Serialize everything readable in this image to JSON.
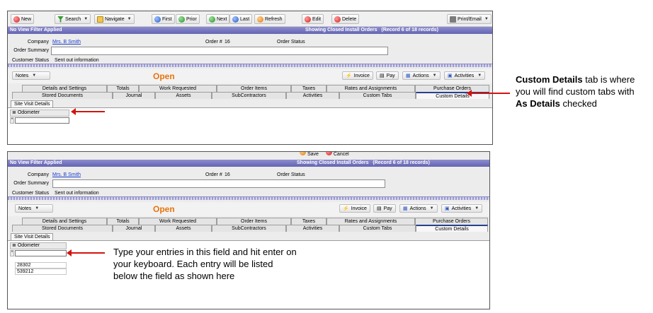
{
  "toolbar": {
    "new": "New",
    "search": "Search",
    "navigate": "Navigate",
    "first": "First",
    "prior": "Prior",
    "next": "Next",
    "last": "Last",
    "refresh": "Refresh",
    "edit": "Edit",
    "delete": "Delete",
    "print_email": "Print/Email"
  },
  "toolbar2": {
    "save": "Save",
    "cancel": "Cancel"
  },
  "bar": {
    "filter": "No View Filter Applied",
    "showing": "Showing Closed Install Orders",
    "record": "(Record 6 of 18 records)"
  },
  "header": {
    "company_label": "Company",
    "company_value": "Mrs. B Smith",
    "order_no_label": "Order #",
    "order_no_value": "16",
    "order_status_label": "Order Status",
    "order_summary_label": "Order Summary",
    "customer_status_label": "Customer Status",
    "customer_status_value": "Sent out information"
  },
  "panel": {
    "notes": "Notes",
    "status": "Open",
    "invoice": "Invoice",
    "pay": "Pay",
    "actions": "Actions",
    "activities": "Activities"
  },
  "tabs_row1": [
    "Details and Settings",
    "Totals",
    "Work Requested",
    "Order Items",
    "Taxes",
    "Rates and Assignments",
    "Purchase Orders"
  ],
  "tabs_row2": [
    "Stored Documents",
    "Journal",
    "Assets",
    "SubContractors",
    "Activities",
    "Custom Tabs",
    "Custom Details"
  ],
  "subtab": "Site Visit Details",
  "grid": {
    "column": "Odometer",
    "row_marker": "*",
    "entries": [
      "28302",
      "539212"
    ]
  },
  "annotations": {
    "top_bold_1": "Custom Details",
    "top_text_1": " tab is where you will find custom tabs with ",
    "top_bold_2": "As Details",
    "top_text_2": " checked",
    "bottom": "Type your entries in this field and hit enter on your keyboard. Each entry will be listed below the field as shown here"
  },
  "colors": {
    "title_bar": "#7373bb",
    "status_orange": "#e7740c",
    "arrow_red": "#d3140f",
    "link_blue": "#1a3fd0"
  }
}
